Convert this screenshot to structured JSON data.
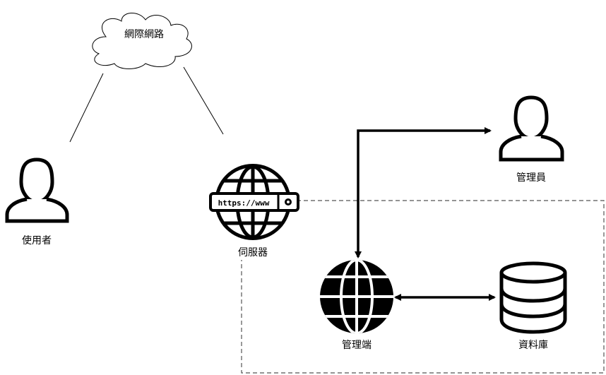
{
  "nodes": {
    "internet": {
      "label": "網際網路",
      "shape": "cloud"
    },
    "user": {
      "label": "使用者",
      "icon": "user-icon"
    },
    "server": {
      "label": "伺服器",
      "icon": "globe-https-icon",
      "url_text": "https://www"
    },
    "admin_person": {
      "label": "管理員",
      "icon": "user-icon"
    },
    "admin_portal": {
      "label": "管理端",
      "icon": "globe-icon"
    },
    "database": {
      "label": "資料庫",
      "icon": "database-icon"
    }
  },
  "edges": [
    {
      "from": "internet",
      "to": "user",
      "style": "line"
    },
    {
      "from": "internet",
      "to": "server",
      "style": "line"
    },
    {
      "from": "admin_portal",
      "to": "admin_person",
      "style": "bidirectional-arrow"
    },
    {
      "from": "admin_portal",
      "to": "database",
      "style": "bidirectional-arrow"
    }
  ],
  "groups": [
    {
      "name": "admin-zone",
      "style": "dashed",
      "members": [
        "admin_portal",
        "database"
      ]
    }
  ],
  "colors": {
    "stroke": "#000000",
    "fill": "#ffffff",
    "dashed_border": "#555555"
  }
}
